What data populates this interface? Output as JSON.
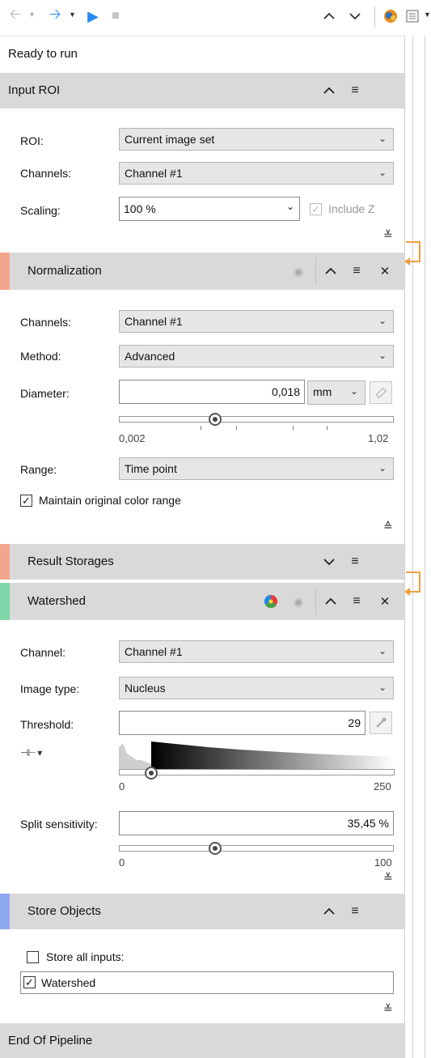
{
  "toolbar": {
    "back_icon": "arrow-left-icon",
    "forward_icon": "arrow-right-icon",
    "run_icon": "play-icon",
    "stop_icon": "stop-icon",
    "up_icon": "chevron-up-icon",
    "down_icon": "chevron-down-icon",
    "brain_icon": "brain-gear-icon",
    "view_icon": "view-options-icon"
  },
  "status": "Ready to run",
  "input_roi": {
    "title": "Input ROI",
    "roi_label": "ROI:",
    "roi_value": "Current image set",
    "channels_label": "Channels:",
    "channels_value": "Channel #1",
    "scaling_label": "Scaling:",
    "scaling_value": "100 %",
    "include_z_label": "Include Z"
  },
  "normalization": {
    "title": "Normalization",
    "stripe_color": "#f5a58c",
    "channels_label": "Channels:",
    "channels_value": "Channel #1",
    "method_label": "Method:",
    "method_value": "Advanced",
    "diameter_label": "Diameter:",
    "diameter_value": "0,018",
    "diameter_unit": "mm",
    "slider_min": "0,002",
    "slider_max": "1,02",
    "range_label": "Range:",
    "range_value": "Time point",
    "maintain_label": "Maintain original color range"
  },
  "result_storages": {
    "title": "Result Storages",
    "stripe_color": "#f5a58c"
  },
  "watershed": {
    "title": "Watershed",
    "stripe_color": "#7fd6a8",
    "channel_label": "Channel:",
    "channel_value": "Channel #1",
    "image_type_label": "Image type:",
    "image_type_value": "Nucleus",
    "threshold_label": "Threshold:",
    "threshold_value": "29",
    "hist_min": "0",
    "hist_max": "250",
    "split_label": "Split sensitivity:",
    "split_value": "35,45 %",
    "split_min": "0",
    "split_max": "100"
  },
  "store_objects": {
    "title": "Store Objects",
    "stripe_color": "#8fa8f0",
    "store_all_label": "Store all inputs:",
    "watershed_label": "Watershed"
  },
  "end": {
    "title": "End Of Pipeline"
  }
}
